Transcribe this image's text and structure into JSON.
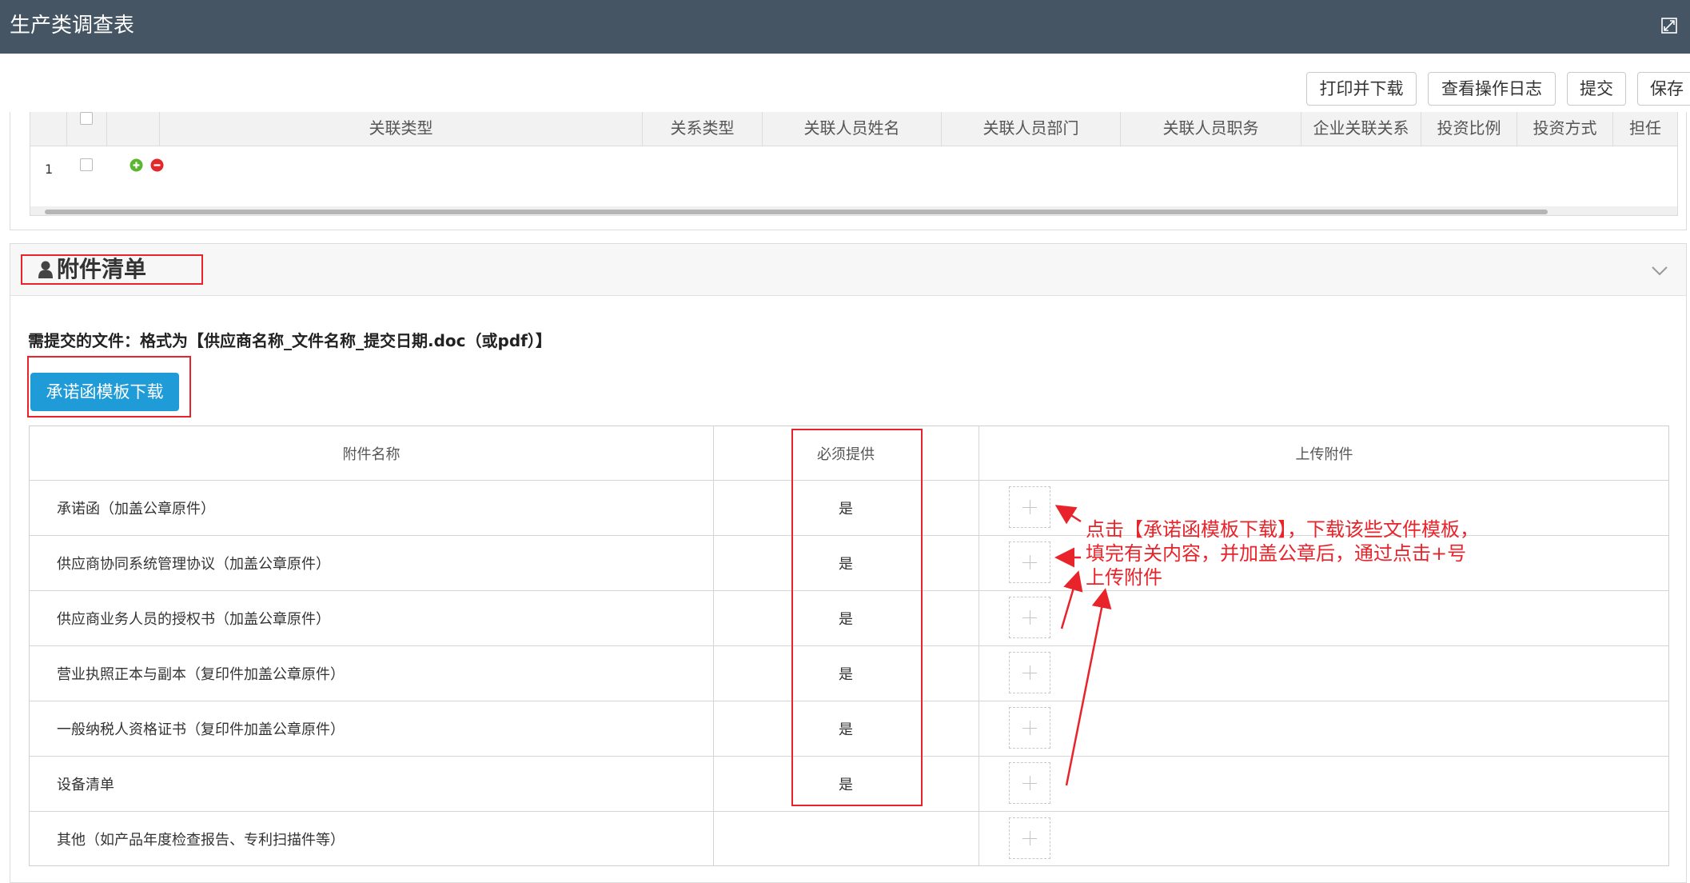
{
  "window": {
    "title": "生产类调查表",
    "maximize_icon": "expand-icon"
  },
  "toolbar": {
    "print_label": "打印并下载",
    "log_label": "查看操作日志",
    "submit_label": "提交",
    "save_label": "保存"
  },
  "relation_table": {
    "columns": [
      "关联类型",
      "关系类型",
      "关联人员姓名",
      "关联人员部门",
      "关联人员职务",
      "企业关联关系",
      "投资比例",
      "投资方式",
      "担任"
    ],
    "rows": [
      {
        "index": "1",
        "add_icon": "plus-circle-icon",
        "remove_icon": "minus-circle-icon"
      }
    ]
  },
  "attachments": {
    "section_title": "附件清单",
    "section_icon": "user-icon",
    "collapse_icon": "chevron-down-icon",
    "requirement_text": "需提交的文件：格式为【供应商名称_文件名称_提交日期.doc（或pdf）】",
    "template_button": "承诺函模板下载",
    "columns": {
      "name": "附件名称",
      "required": "必须提供",
      "upload": "上传附件"
    },
    "rows": [
      {
        "name": "承诺函（加盖公章原件）",
        "required": "是"
      },
      {
        "name": "供应商协同系统管理协议（加盖公章原件）",
        "required": "是"
      },
      {
        "name": "供应商业务人员的授权书（加盖公章原件）",
        "required": "是"
      },
      {
        "name": "营业执照正本与副本（复印件加盖公章原件）",
        "required": "是"
      },
      {
        "name": "一般纳税人资格证书（复印件加盖公章原件）",
        "required": "是"
      },
      {
        "name": "设备清单",
        "required": "是"
      },
      {
        "name": "其他（如产品年度检查报告、专利扫描件等）",
        "required": ""
      }
    ]
  },
  "annotation": {
    "lines": [
      "点击【承诺函模板下载】，下载该些文件模板，",
      "填完有关内容，并加盖公章后，通过点击+号",
      "上传附件"
    ],
    "color": "#e8232a"
  }
}
